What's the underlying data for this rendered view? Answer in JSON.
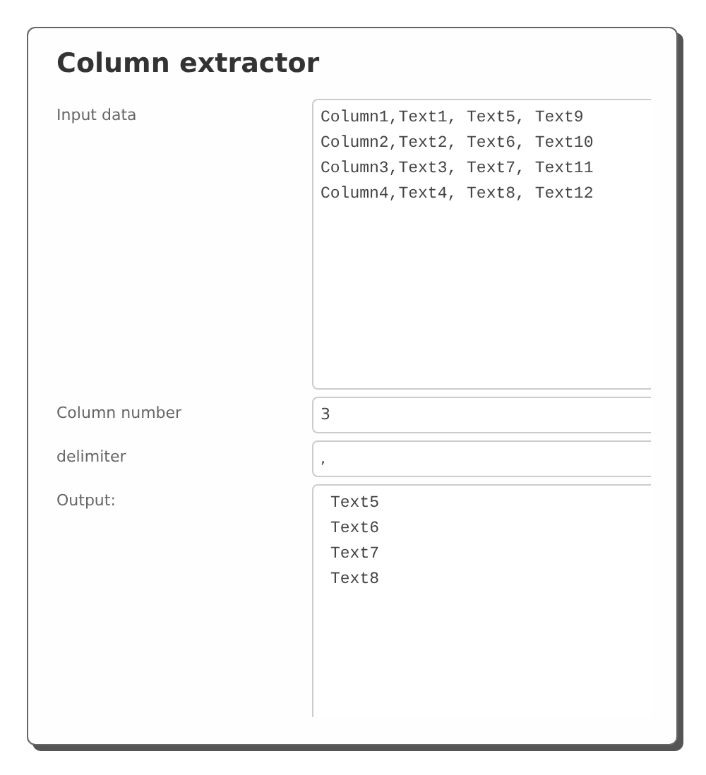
{
  "title": "Column extractor",
  "fields": [
    {
      "kind": "textarea",
      "label": "Input data",
      "value": "Column1,Text1, Text5, Text9\nColumn2,Text2, Text6, Text10\nColumn3,Text3, Text7, Text11\nColumn4,Text4, Text8, Text12"
    },
    {
      "kind": "input",
      "label": "Column number",
      "value": "3"
    },
    {
      "kind": "input",
      "label": "delimiter",
      "value": ","
    },
    {
      "kind": "output",
      "label": "Output:",
      "value": "Text5\nText6\nText7\nText8"
    }
  ]
}
